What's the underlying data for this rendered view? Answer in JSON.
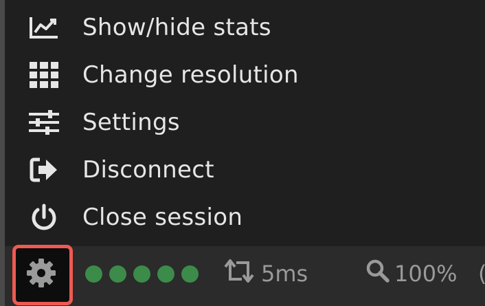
{
  "menu": {
    "items": [
      {
        "label": "Show/hide stats",
        "icon": "chart-line-icon"
      },
      {
        "label": "Change resolution",
        "icon": "grid-icon"
      },
      {
        "label": "Settings",
        "icon": "sliders-icon"
      },
      {
        "label": "Disconnect",
        "icon": "sign-out-icon"
      },
      {
        "label": "Close session",
        "icon": "power-icon"
      }
    ]
  },
  "statusbar": {
    "settings_icon": "gear-icon",
    "signal_strength": 5,
    "signal_max": 5,
    "latency": "5ms",
    "zoom": "100%",
    "trailing": "("
  },
  "colors": {
    "menu_background": "#1f1f1f",
    "statusbar_background": "#2b2b2b",
    "text": "#e6e6e6",
    "muted_text": "#9a9a9a",
    "signal": "#3c8b4a",
    "highlight": "#ee5a52"
  }
}
